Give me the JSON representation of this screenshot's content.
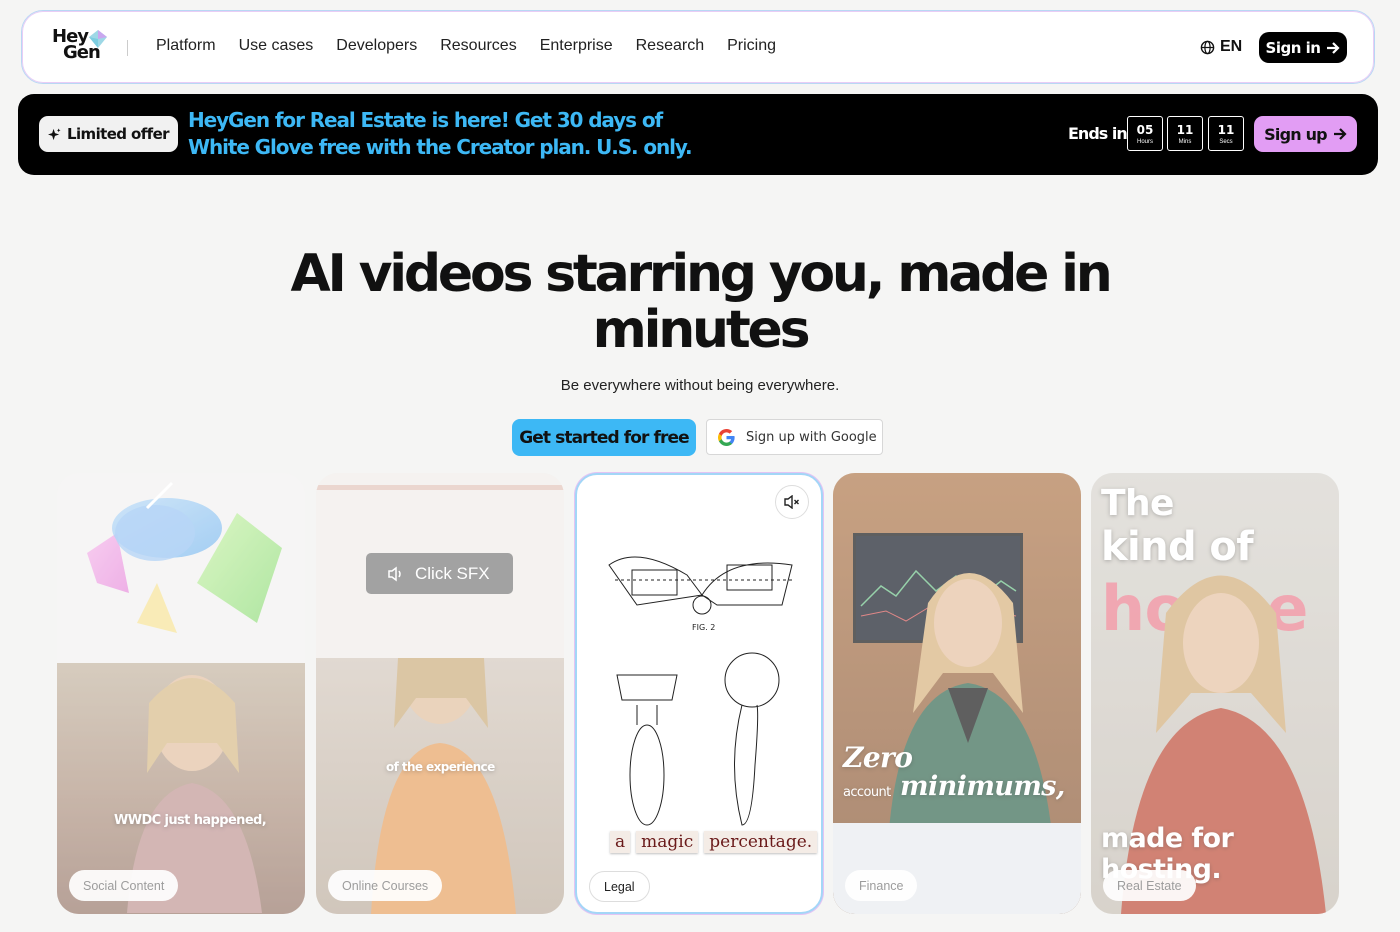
{
  "brand": {
    "logo_line1": "Hey",
    "logo_line2": "Gen"
  },
  "nav": {
    "items": [
      "Platform",
      "Use cases",
      "Developers",
      "Resources",
      "Enterprise",
      "Research",
      "Pricing"
    ],
    "language": "EN",
    "sign_in": "Sign in"
  },
  "banner": {
    "badge": "Limited offer",
    "message": "HeyGen for Real Estate is here! Get 30 days of White Glove free with the Creator plan. U.S. only.",
    "ends_label": "Ends in",
    "timer": [
      {
        "value": "05",
        "unit": "Hours"
      },
      {
        "value": "11",
        "unit": "Mins"
      },
      {
        "value": "11",
        "unit": "Secs"
      }
    ],
    "sign_up": "Sign up",
    "message_color": "#3db8f5",
    "signup_color": "#e29df4"
  },
  "hero": {
    "title": "AI videos starring you, made in minutes",
    "subtitle": "Be everywhere without being everywhere.",
    "cta_primary": "Get started for free",
    "cta_google": "Sign up with Google"
  },
  "cards": [
    {
      "tag": "Social Content",
      "caption": "WWDC just happened,"
    },
    {
      "tag": "Online Courses",
      "caption": "of the experience",
      "overlay": "Click SFX"
    },
    {
      "tag": "Legal",
      "caption_words": [
        "a",
        "magic",
        "percentage."
      ],
      "figure_label": "FIG. 2"
    },
    {
      "tag": "Finance",
      "caption_part1": "Zero",
      "caption_part2": "account",
      "caption_part3": "minimums,"
    },
    {
      "tag": "Real Estate",
      "caption_top1": "The",
      "caption_top2": "kind of",
      "caption_top3": "house",
      "caption_bottom": "made for hosting."
    }
  ]
}
